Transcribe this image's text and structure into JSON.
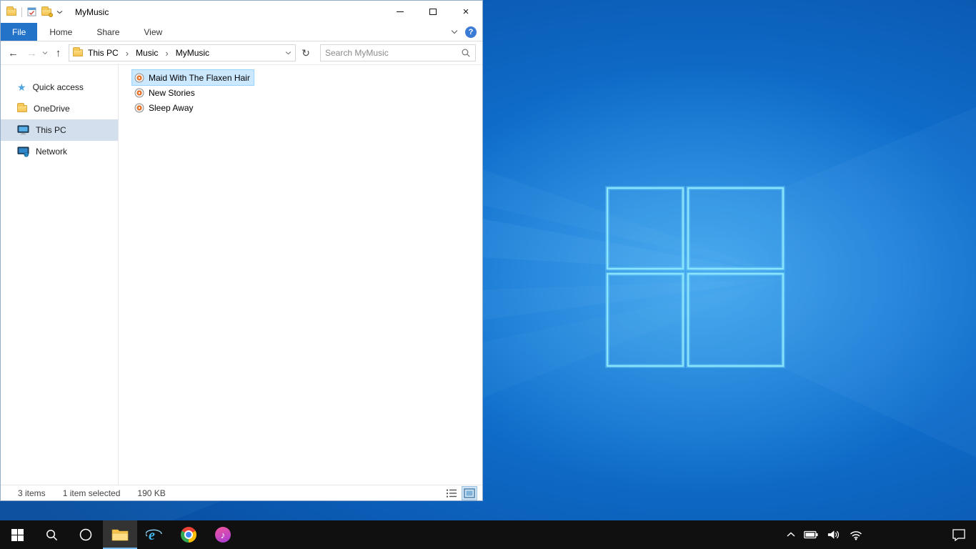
{
  "explorer": {
    "title": "MyMusic",
    "ribbon": {
      "file_tab": "File",
      "tabs": [
        {
          "label": "Home"
        },
        {
          "label": "Share"
        },
        {
          "label": "View"
        }
      ]
    },
    "address": {
      "breadcrumb": [
        "This PC",
        "Music",
        "MyMusic"
      ],
      "separator": "›"
    },
    "search": {
      "placeholder": "Search MyMusic"
    },
    "sidebar": {
      "items": [
        {
          "label": "Quick access",
          "selected": false
        },
        {
          "label": "OneDrive",
          "selected": false
        },
        {
          "label": "This PC",
          "selected": true
        },
        {
          "label": "Network",
          "selected": false
        }
      ]
    },
    "files": [
      {
        "name": "Maid With The Flaxen Hair",
        "selected": true
      },
      {
        "name": "New Stories",
        "selected": false
      },
      {
        "name": "Sleep Away",
        "selected": false
      }
    ],
    "status": {
      "count": "3 items",
      "selected": "1 item selected",
      "size": "190 KB"
    }
  },
  "icons": {
    "back": "←",
    "forward": "→",
    "up": "↑",
    "refresh": "↻",
    "close": "×",
    "help": "?",
    "star": "★",
    "music_note": "♪"
  },
  "colors": {
    "accent": "#2373c8",
    "selection_bg": "#cce8ff",
    "selection_border": "#99d1ff",
    "sidebar_selected": "#d3dfec",
    "taskbar_bg": "#101010",
    "wallpaper_base": "#0f6ecb",
    "logo_stroke": "#7ae0ff"
  }
}
